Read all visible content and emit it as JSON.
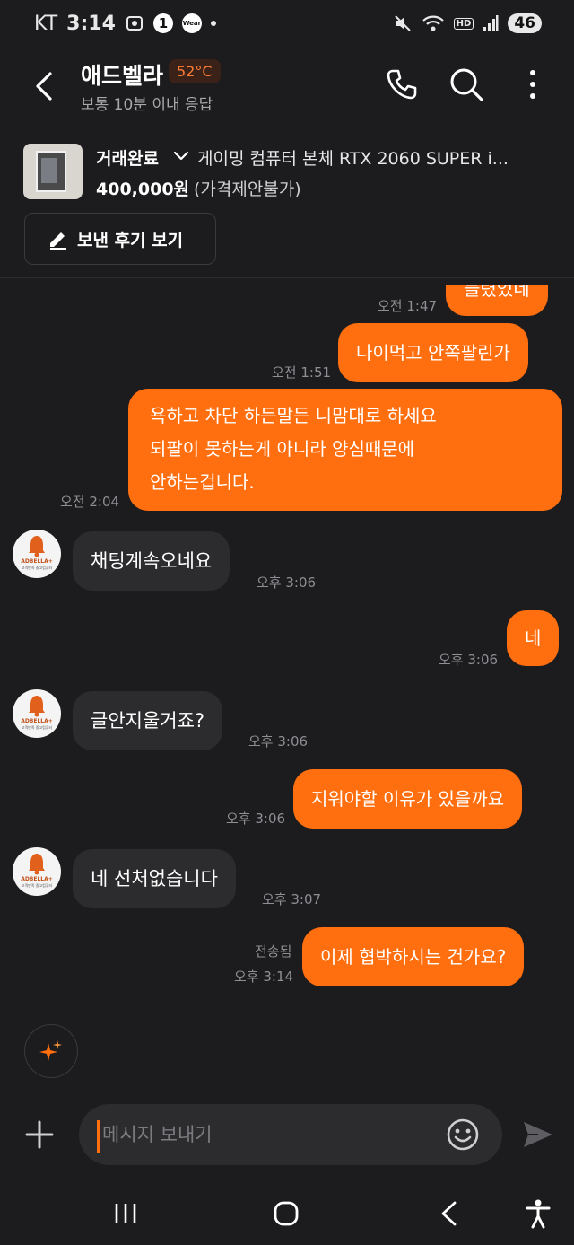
{
  "status_bar": {
    "carrier": "KT",
    "time": "3:14",
    "notif_count": "1",
    "wear_label": "Wear",
    "hd_label": "HD",
    "battery": "46"
  },
  "header": {
    "name": "애드벨라",
    "temperature": "52°C",
    "subtitle": "보통 10분 이내 응답"
  },
  "product": {
    "status": "거래완료",
    "title": "게이밍 컴퓨터 본체 RTX 2060 SUPER i...",
    "price": "400,000원",
    "price_note": "(가격제안불가)",
    "review_button": "보낸 후기 보기"
  },
  "messages": [
    {
      "side": "out",
      "text": "들렸었네",
      "time": "오전 1:47"
    },
    {
      "side": "out",
      "text": "나이먹고 안쪽팔린가",
      "time": "오전 1:51"
    },
    {
      "side": "out",
      "lines": [
        "욕하고 차단 하든말든 니맘대로 하세요",
        "되팔이 못하는게 아니라 양심때문에",
        "안하는겁니다."
      ],
      "time": "오전 2:04"
    },
    {
      "side": "in",
      "text": "채팅계속오네요",
      "time": "오후 3:06"
    },
    {
      "side": "out",
      "text": "네",
      "time": "오후 3:06"
    },
    {
      "side": "in",
      "text": "글안지울거죠?",
      "time": "오후 3:06"
    },
    {
      "side": "out",
      "text": "지워야할 이유가 있을까요",
      "time": "오후 3:06"
    },
    {
      "side": "in",
      "text": "네 선처없습니다",
      "time": "오후 3:07"
    },
    {
      "side": "out",
      "text": "이제 협박하시는 건가요?",
      "time": "오후 3:14",
      "status": "전송됨"
    }
  ],
  "avatar": {
    "brand": "ADBELLA+",
    "tagline": "고객만족 중고컴퓨터"
  },
  "composer": {
    "placeholder": "메시지 보내기"
  },
  "colors": {
    "accent": "#ff6f0f",
    "background": "#1c1c1e",
    "bubble_in": "#2c2c2e"
  },
  "icons": [
    "back-icon",
    "phone-icon",
    "search-icon",
    "more-icon",
    "chevron-down-icon",
    "pencil-icon",
    "sparkle-icon",
    "plus-icon",
    "emoji-icon",
    "send-icon",
    "recents-icon",
    "home-icon",
    "nav-back-icon",
    "accessibility-icon"
  ]
}
